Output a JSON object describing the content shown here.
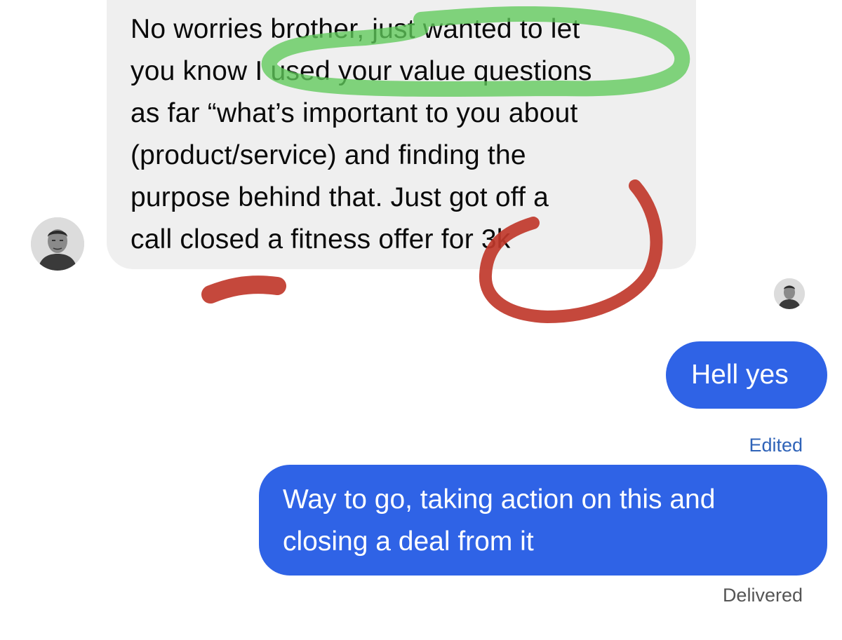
{
  "incoming_message": {
    "lines": [
      "No worries brother, just wanted to let",
      "you know I used your value questions",
      "as far “what’s important to you about",
      "(product/service) and finding the",
      "purpose behind that. Just got off a",
      "call closed a fitness offer for 3k"
    ]
  },
  "outgoing_messages": {
    "hell_yes": "Hell yes",
    "edited_label": "Edited",
    "way_to_go_lines": [
      "Way to go, taking action on this and",
      "closing a deal from it"
    ],
    "delivered_label": "Delivered"
  },
  "colors": {
    "incoming_bubble": "#efefef",
    "outgoing_bubble": "#2f63e6",
    "green_highlight": "#5fc95a",
    "red_marker": "#c0382b"
  },
  "icons": {
    "contact_avatar": "avatar-icon",
    "read_receipt_avatar": "avatar-icon"
  }
}
